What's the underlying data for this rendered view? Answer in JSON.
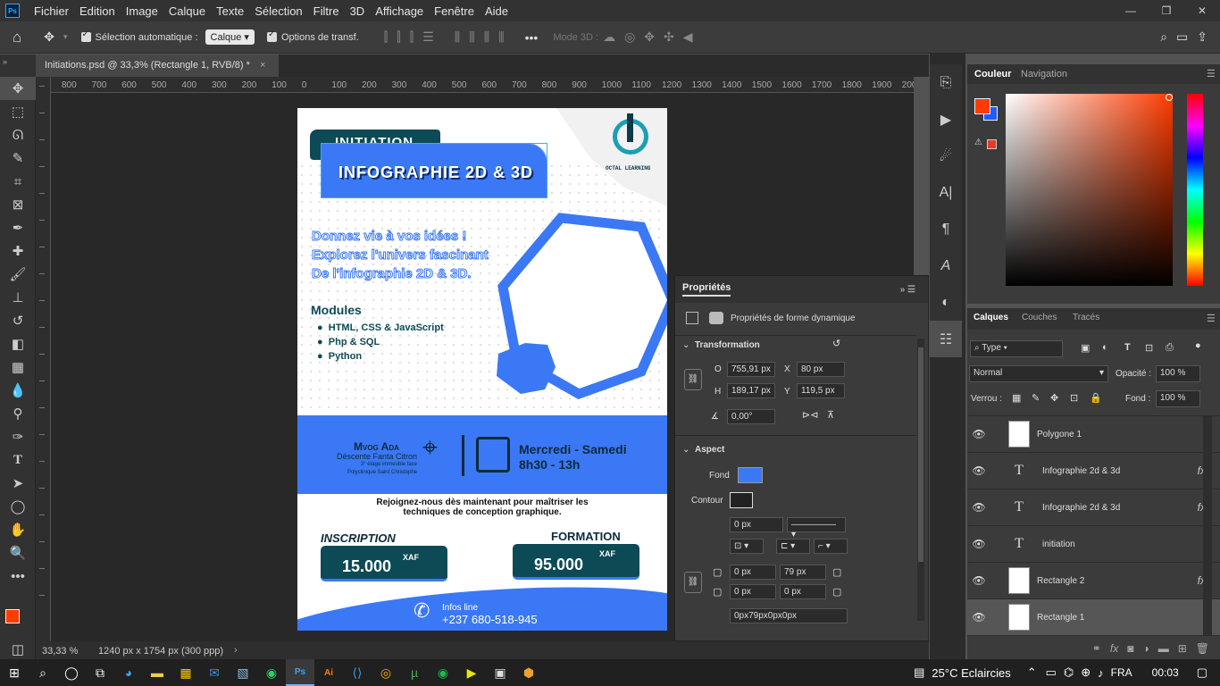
{
  "menu": {
    "logo": "Ps",
    "items": [
      "Fichier",
      "Edition",
      "Image",
      "Calque",
      "Texte",
      "Sélection",
      "Filtre",
      "3D",
      "Affichage",
      "Fenêtre",
      "Aide"
    ]
  },
  "options": {
    "auto_select": "Sélection automatique :",
    "auto_select_value": "Calque",
    "transform": "Options de transf.",
    "mode3d": "Mode 3D :",
    "more": "•••"
  },
  "doc_tab": {
    "title": "Initiations.psd @ 33,3% (Rectangle 1, RVB/8) *",
    "close": "×"
  },
  "ruler": {
    "h": [
      "800",
      "700",
      "600",
      "500",
      "400",
      "300",
      "200",
      "100",
      "0",
      "100",
      "200",
      "300",
      "400",
      "500",
      "600",
      "700",
      "800",
      "900",
      "1000",
      "1100",
      "1200",
      "1300",
      "1400",
      "1500",
      "1600",
      "1700",
      "1800",
      "1900",
      "2000"
    ]
  },
  "status": {
    "zoom": "33,33 %",
    "size": "1240 px x 1754 px (300 ppp)"
  },
  "poster": {
    "badge1": "INITIATION",
    "badge2": "INFOGRAPHIE 2D & 3D",
    "brand": "OCTAL LEARNING",
    "tagline": [
      "Donnez vie à vos idées !",
      "Explorez l'univers fascinant",
      "De l'infographie 2D & 3D."
    ],
    "modules_title": "Modules",
    "modules": [
      "HTML, CSS & JavaScript",
      "Php & SQL",
      "Python"
    ],
    "place_title": "Mvog Ada",
    "place_lines": [
      "Déscente Fanta Citron",
      "3° étage immeuble face",
      "Polyclinique Saint Christophe"
    ],
    "days": "Mercredi - Samedi",
    "hours": "8h30 - 13h",
    "join": [
      "Rejoignez-nous dès maintenant pour maîtriser les",
      "techniques de conception graphique."
    ],
    "inscription_label": "INSCRIPTION",
    "inscription_price": "15.000",
    "formation_label": "FORMATION",
    "formation_price": "95.000",
    "currency": "XAF",
    "info_label": "Infos line",
    "phone": "+237 680-518-945"
  },
  "properties": {
    "tab": "Propriétés",
    "subtitle": "Propriétés de forme dynamique",
    "transform": "Transformation",
    "w_label": "O",
    "w": "755,91 px",
    "x_label": "X",
    "x": "80 px",
    "h_label": "H",
    "h": "189,17 px",
    "y_label": "Y",
    "y": "119,5 px",
    "angle": "0,00°",
    "aspect": "Aspect",
    "fond_label": "Fond",
    "contour_label": "Contour",
    "stroke_w": "0 px",
    "r1": "0 px",
    "r2": "79 px",
    "r3": "0 px",
    "r4": "0 px",
    "radii_summary": "0px79px0px0px",
    "fill_color": "#3b78f5"
  },
  "color_panel": {
    "tabs": [
      "Couleur",
      "Navigation"
    ],
    "fg": "#ff3b00",
    "bg": "#1e5cff"
  },
  "layers_panel": {
    "tabs": [
      "Calques",
      "Couches",
      "Tracés"
    ],
    "filter": "Type",
    "blend": "Normal",
    "opacity_label": "Opacité :",
    "opacity": "100 %",
    "lock_label": "Verrou :",
    "fill_label": "Fond :",
    "fill": "100 %",
    "layers": [
      {
        "name": "Polygone 1",
        "kind": "shape",
        "fx": ""
      },
      {
        "name": "Infographie 2d & 3d",
        "kind": "text",
        "fx": "fx"
      },
      {
        "name": "Infographie 2d & 3d",
        "kind": "text",
        "fx": "fx"
      },
      {
        "name": "initiation",
        "kind": "text",
        "fx": ""
      },
      {
        "name": "Rectangle 2",
        "kind": "shape",
        "fx": "fx"
      },
      {
        "name": "Rectangle 1",
        "kind": "shape",
        "fx": ""
      }
    ]
  },
  "taskbar": {
    "weather": "25°C  Eclaircies",
    "lang": "FRA",
    "time": "00:03"
  }
}
